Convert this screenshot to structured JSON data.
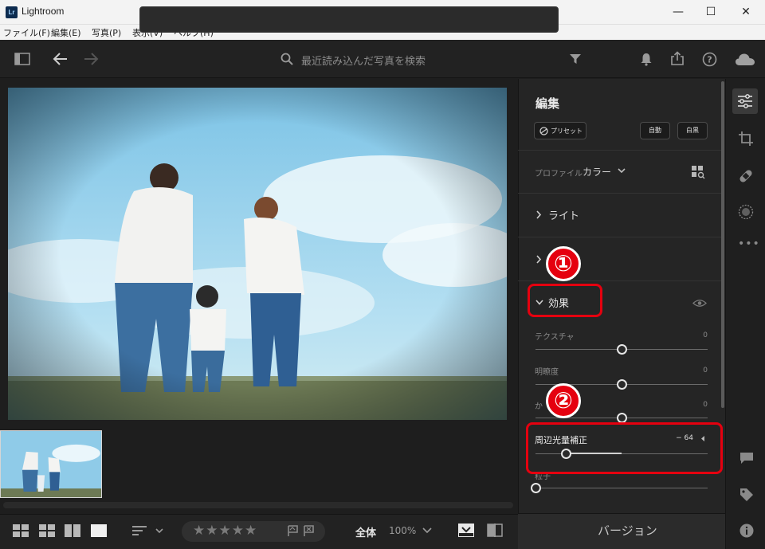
{
  "window": {
    "app_icon_text": "Lr",
    "title": "Lightroom",
    "minimize": "—",
    "maximize": "☐",
    "close": "✕"
  },
  "menu": [
    "ファイル(F)",
    "編集(E)",
    "写真(P)",
    "表示(V)",
    "ヘルプ(H)"
  ],
  "search": {
    "placeholder": "最近読み込んだ写真を検索"
  },
  "edit_panel": {
    "title": "編集",
    "preset_button": "プリセット",
    "auto_button": "自動",
    "bw_button": "白黒",
    "profile_label": "プロファイル",
    "profile_value": "カラー",
    "sections": {
      "light": "ライト",
      "effects": "効果"
    },
    "sliders": [
      {
        "label": "テクスチャ",
        "value": "0",
        "level": 0.5
      },
      {
        "label": "明瞭度",
        "value": "0",
        "level": 0.5
      },
      {
        "label": "かすみの除去",
        "visible_label": "か",
        "value": "0",
        "level": 0.5
      },
      {
        "label": "周辺光量補正",
        "value": "− 64",
        "level": 0.18
      },
      {
        "label": "粒子",
        "value": "",
        "level": 0.0
      }
    ]
  },
  "annotations": {
    "badge1": "①",
    "badge2": "②"
  },
  "bottom_bar": {
    "zoom_label": "全体",
    "zoom_value": "100%",
    "stars": "★★★★★"
  },
  "version_bar": {
    "label": "バージョン"
  },
  "colors": {
    "accent_red": "#e5000f",
    "panel_bg": "#252525",
    "app_bg": "#1e1e1e"
  }
}
